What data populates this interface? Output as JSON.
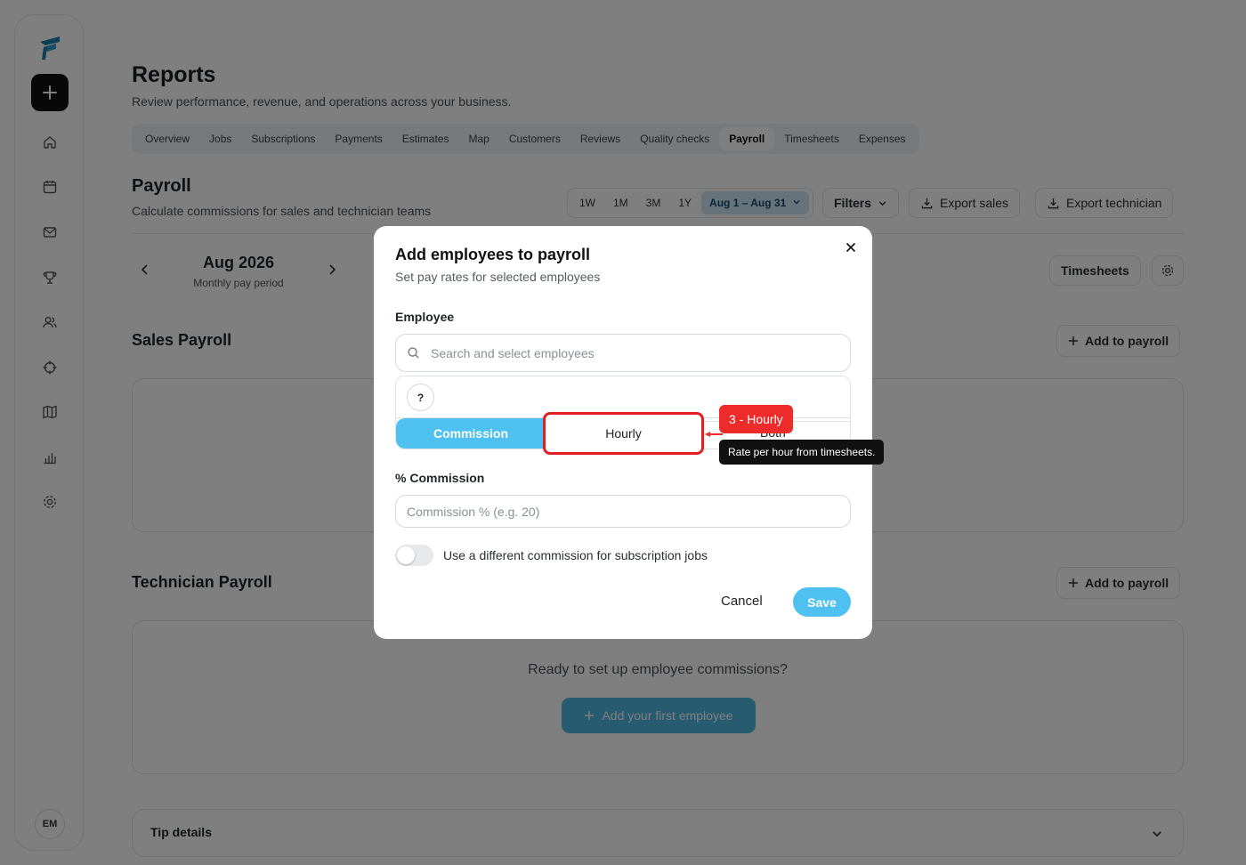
{
  "sidebar": {
    "nav_icons": [
      "home-icon",
      "calendar-icon",
      "mail-icon",
      "trophy-icon",
      "users-icon",
      "target-icon",
      "map-icon",
      "chart-icon",
      "gear-icon"
    ],
    "avatar_initials": "EM"
  },
  "page": {
    "title": "Reports",
    "subtitle": "Review performance, revenue, and operations across your business."
  },
  "tabs": [
    "Overview",
    "Jobs",
    "Subscriptions",
    "Payments",
    "Estimates",
    "Map",
    "Customers",
    "Reviews",
    "Quality checks",
    "Payroll",
    "Timesheets",
    "Expenses"
  ],
  "active_tab": "Payroll",
  "payroll": {
    "title": "Payroll",
    "subtitle": "Calculate commissions for sales and technician teams",
    "ranges": [
      "1W",
      "1M",
      "3M",
      "1Y"
    ],
    "date_range": "Aug 1 – Aug 31",
    "filters_label": "Filters",
    "export_sales_label": "Export sales",
    "export_technician_label": "Export technician",
    "month": "Aug 2026",
    "month_sub": "Monthly pay period",
    "timesheets_label": "Timesheets"
  },
  "sales_payroll": {
    "title": "Sales Payroll",
    "add_label": "Add to payroll"
  },
  "technician_payroll": {
    "title": "Technician Payroll",
    "add_label": "Add to payroll",
    "empty_text": "Ready to set up employee commissions?",
    "first_employee_label": "Add your first employee"
  },
  "tip_details": {
    "title": "Tip details"
  },
  "modal": {
    "title": "Add employees to payroll",
    "subtitle": "Set pay rates for selected employees",
    "employee_label": "Employee",
    "search_placeholder": "Search and select employees",
    "chip": "?",
    "pay_types": [
      "Commission",
      "Hourly",
      "Both"
    ],
    "selected_pay_type": "Hourly",
    "commission_label": "% Commission",
    "commission_placeholder": "Commission % (e.g. 20)",
    "toggle_label": "Use a different commission for subscription jobs",
    "toggle_on": false,
    "cancel_label": "Cancel",
    "save_label": "Save"
  },
  "annotation": {
    "badge": "3 - Hourly",
    "tooltip": "Rate per hour from timesheets.",
    "color": "#ee2b2b"
  },
  "colors": {
    "accent": "#4fc1f0",
    "brand": "#1a7fa8"
  }
}
